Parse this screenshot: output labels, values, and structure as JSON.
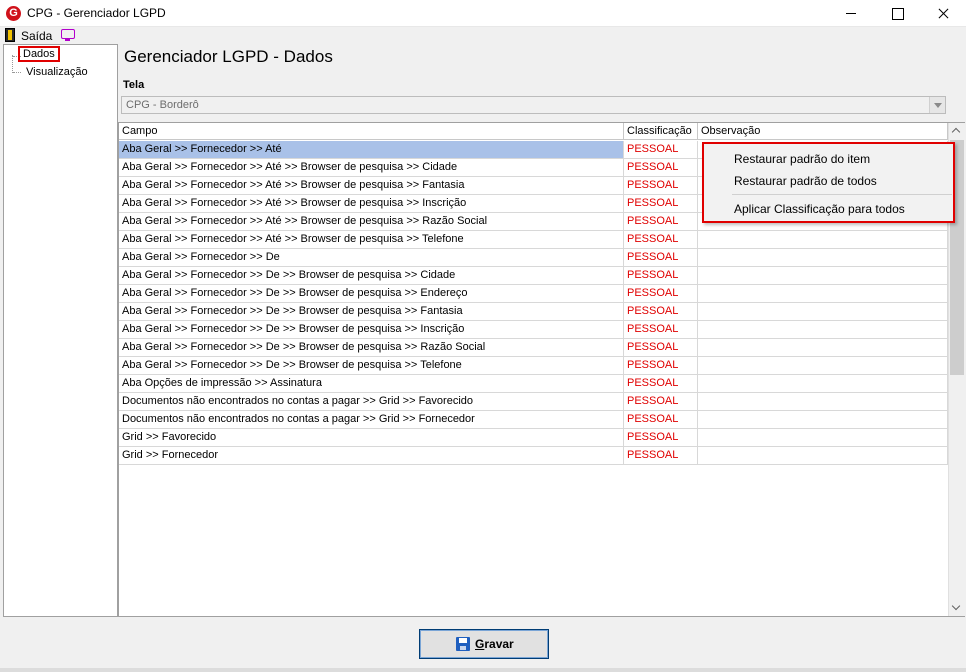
{
  "window": {
    "title": "CPG - Gerenciador LGPD",
    "icon_letter": "G"
  },
  "menu": {
    "exit_label": "Saída"
  },
  "tree": {
    "items": [
      {
        "label": "Dados",
        "highlighted": true
      },
      {
        "label": "Visualização"
      }
    ]
  },
  "main": {
    "heading": "Gerenciador LGPD - Dados",
    "tela_label": "Tela",
    "tela_value": "CPG - Borderô"
  },
  "grid": {
    "columns": [
      "Campo",
      "Classificação",
      "Observação"
    ],
    "rows": [
      {
        "campo": "Aba Geral >> Fornecedor >> Até",
        "classificacao": "PESSOAL",
        "observacao": "",
        "selected": true
      },
      {
        "campo": "Aba Geral >> Fornecedor >> Até >> Browser de pesquisa >> Cidade",
        "classificacao": "PESSOAL",
        "observacao": ""
      },
      {
        "campo": "Aba Geral >> Fornecedor >> Até >> Browser de pesquisa >> Fantasia",
        "classificacao": "PESSOAL",
        "observacao": ""
      },
      {
        "campo": "Aba Geral >> Fornecedor >> Até >> Browser de pesquisa >> Inscrição",
        "classificacao": "PESSOAL",
        "observacao": ""
      },
      {
        "campo": "Aba Geral >> Fornecedor >> Até >> Browser de pesquisa >> Razão Social",
        "classificacao": "PESSOAL",
        "observacao": ""
      },
      {
        "campo": "Aba Geral >> Fornecedor >> Até >> Browser de pesquisa >> Telefone",
        "classificacao": "PESSOAL",
        "observacao": ""
      },
      {
        "campo": "Aba Geral >> Fornecedor >> De",
        "classificacao": "PESSOAL",
        "observacao": ""
      },
      {
        "campo": "Aba Geral >> Fornecedor >> De >> Browser de pesquisa >> Cidade",
        "classificacao": "PESSOAL",
        "observacao": ""
      },
      {
        "campo": "Aba Geral >> Fornecedor >> De >> Browser de pesquisa >> Endereço",
        "classificacao": "PESSOAL",
        "observacao": ""
      },
      {
        "campo": "Aba Geral >> Fornecedor >> De >> Browser de pesquisa >> Fantasia",
        "classificacao": "PESSOAL",
        "observacao": ""
      },
      {
        "campo": "Aba Geral >> Fornecedor >> De >> Browser de pesquisa >> Inscrição",
        "classificacao": "PESSOAL",
        "observacao": ""
      },
      {
        "campo": "Aba Geral >> Fornecedor >> De >> Browser de pesquisa >> Razão Social",
        "classificacao": "PESSOAL",
        "observacao": ""
      },
      {
        "campo": "Aba Geral >> Fornecedor >> De >> Browser de pesquisa >> Telefone",
        "classificacao": "PESSOAL",
        "observacao": ""
      },
      {
        "campo": "Aba Opções de impressão >> Assinatura",
        "classificacao": "PESSOAL",
        "observacao": ""
      },
      {
        "campo": "Documentos não encontrados no contas a pagar >> Grid >> Favorecido",
        "classificacao": "PESSOAL",
        "observacao": ""
      },
      {
        "campo": "Documentos não encontrados no contas a pagar >> Grid >> Fornecedor",
        "classificacao": "PESSOAL",
        "observacao": ""
      },
      {
        "campo": "Grid >> Favorecido",
        "classificacao": "PESSOAL",
        "observacao": ""
      },
      {
        "campo": "Grid >> Fornecedor",
        "classificacao": "PESSOAL",
        "observacao": ""
      }
    ]
  },
  "context_menu": {
    "items": [
      "Restaurar padrão do item",
      "Restaurar padrão de todos",
      "Aplicar Classificação para todos"
    ]
  },
  "footer": {
    "save_label_prefix": "G",
    "save_label_rest": "ravar"
  },
  "colors": {
    "classification_text": "#e00000",
    "highlight_border": "#e00000",
    "selected_row": "#a9c1e8"
  }
}
